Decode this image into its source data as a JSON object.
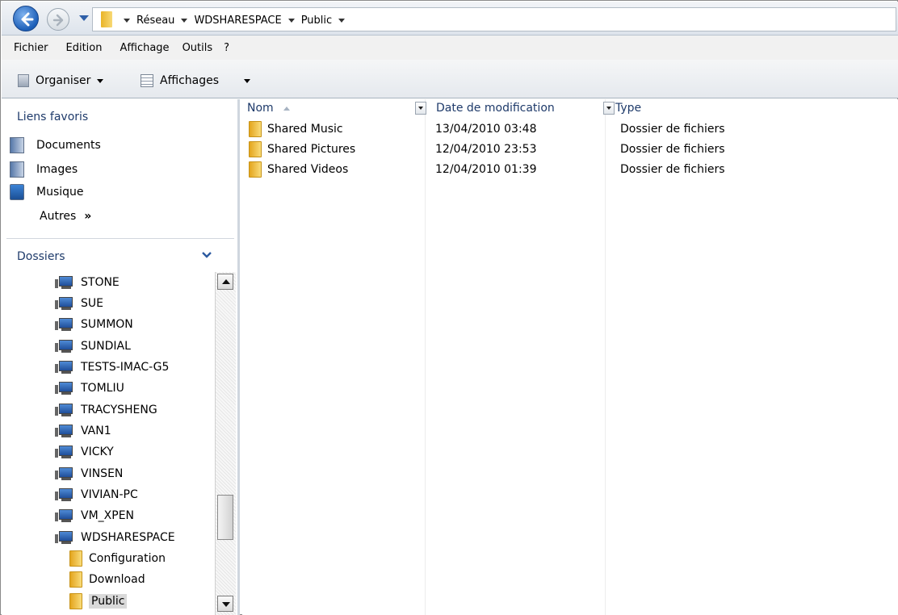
{
  "address_bar": {
    "breadcrumbs": [
      "Réseau",
      "WDSHARESPACE",
      "Public"
    ]
  },
  "menu": [
    "Fichier",
    "Edition",
    "Affichage",
    "Outils",
    "?"
  ],
  "toolbar": {
    "organise_label": "Organiser",
    "views_label": "Affichages"
  },
  "favorites": {
    "title": "Liens favoris",
    "items": [
      {
        "label": "Documents",
        "icon": "documents-icon"
      },
      {
        "label": "Images",
        "icon": "images-icon"
      },
      {
        "label": "Musique",
        "icon": "music-icon"
      }
    ],
    "more_label": "Autres",
    "more_glyph": "»"
  },
  "folders": {
    "title": "Dossiers",
    "tree": [
      {
        "label": "STONE",
        "kind": "computer"
      },
      {
        "label": "SUE",
        "kind": "computer"
      },
      {
        "label": "SUMMON",
        "kind": "computer"
      },
      {
        "label": "SUNDIAL",
        "kind": "computer"
      },
      {
        "label": "TESTS-IMAC-G5",
        "kind": "computer"
      },
      {
        "label": "TOMLIU",
        "kind": "computer"
      },
      {
        "label": "TRACYSHENG",
        "kind": "computer"
      },
      {
        "label": "VAN1",
        "kind": "computer"
      },
      {
        "label": "VICKY",
        "kind": "computer"
      },
      {
        "label": "VINSEN",
        "kind": "computer"
      },
      {
        "label": "VIVIAN-PC",
        "kind": "computer"
      },
      {
        "label": "VM_XPEN",
        "kind": "computer"
      },
      {
        "label": "WDSHARESPACE",
        "kind": "computer"
      },
      {
        "label": "Configuration",
        "kind": "folder"
      },
      {
        "label": "Download",
        "kind": "folder"
      },
      {
        "label": "Public",
        "kind": "folder",
        "selected": true
      }
    ]
  },
  "file_list": {
    "columns": [
      "Nom",
      "Date de modification",
      "Type"
    ],
    "rows": [
      {
        "name": "Shared Music",
        "date": "13/04/2010 03:48",
        "type": "Dossier de fichiers"
      },
      {
        "name": "Shared Pictures",
        "date": "12/04/2010 23:53",
        "type": "Dossier de fichiers"
      },
      {
        "name": "Shared Videos",
        "date": "12/04/2010 01:39",
        "type": "Dossier de fichiers"
      }
    ]
  },
  "colors": {
    "header_text": "#1e3a6a",
    "folder_yellow": "#e4a51e",
    "back_button_blue": "#1c5fb8"
  }
}
